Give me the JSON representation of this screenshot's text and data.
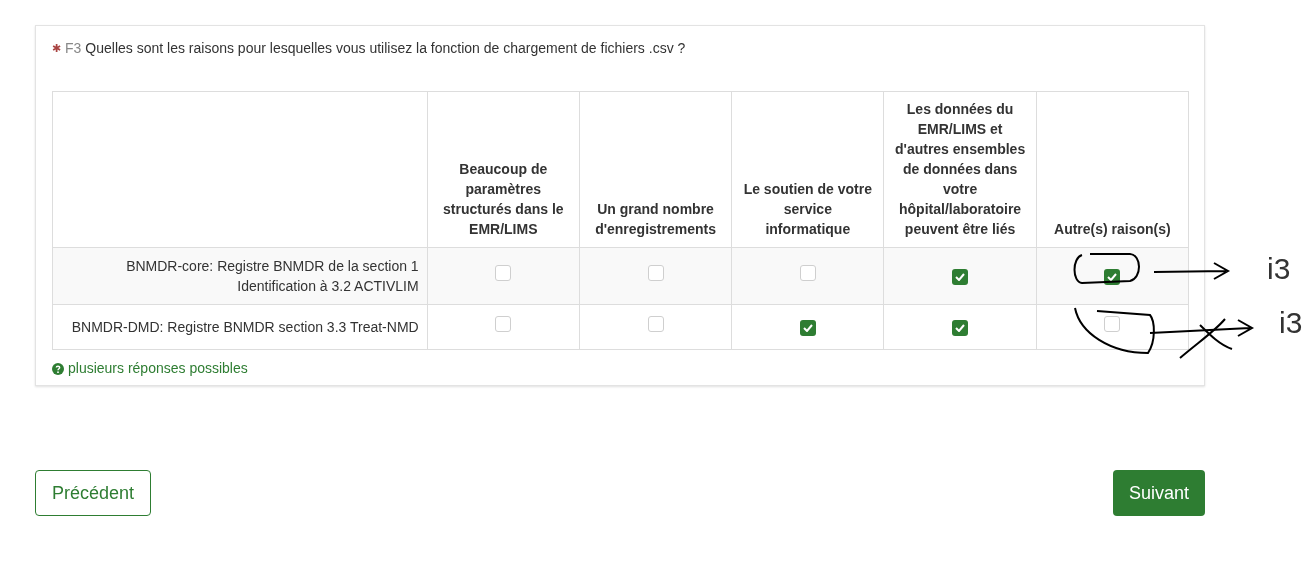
{
  "question": {
    "required_mark": "✱",
    "number": "F3",
    "text": "Quelles sont les raisons pour lesquelles vous utilisez la fonction de chargement de fichiers .csv ?"
  },
  "table": {
    "columns": [
      "Beaucoup de paramètres structurés dans le EMR/LIMS",
      "Un grand nombre d'enregistrements",
      "Le soutien de votre service informatique",
      "Les données du EMR/LIMS et d'autres ensembles de données dans votre hôpital/laboratoire peuvent être liés",
      "Autre(s) raison(s)"
    ],
    "rows": [
      {
        "label": "BNMDR-core: Registre BNMDR de la section 1 Identification à 3.2 ACTIVLIM",
        "checked": [
          false,
          false,
          false,
          true,
          true
        ]
      },
      {
        "label": "BNMDR-DMD: Registre BNMDR section 3.3 Treat-NMD",
        "checked": [
          false,
          false,
          true,
          true,
          false
        ]
      }
    ]
  },
  "hint": "plusieurs réponses possibles",
  "buttons": {
    "previous": "Précédent",
    "next": "Suivant"
  },
  "annotations": [
    {
      "kind": "arrow",
      "label": "i3"
    },
    {
      "kind": "crossed",
      "label": "i3"
    }
  ]
}
